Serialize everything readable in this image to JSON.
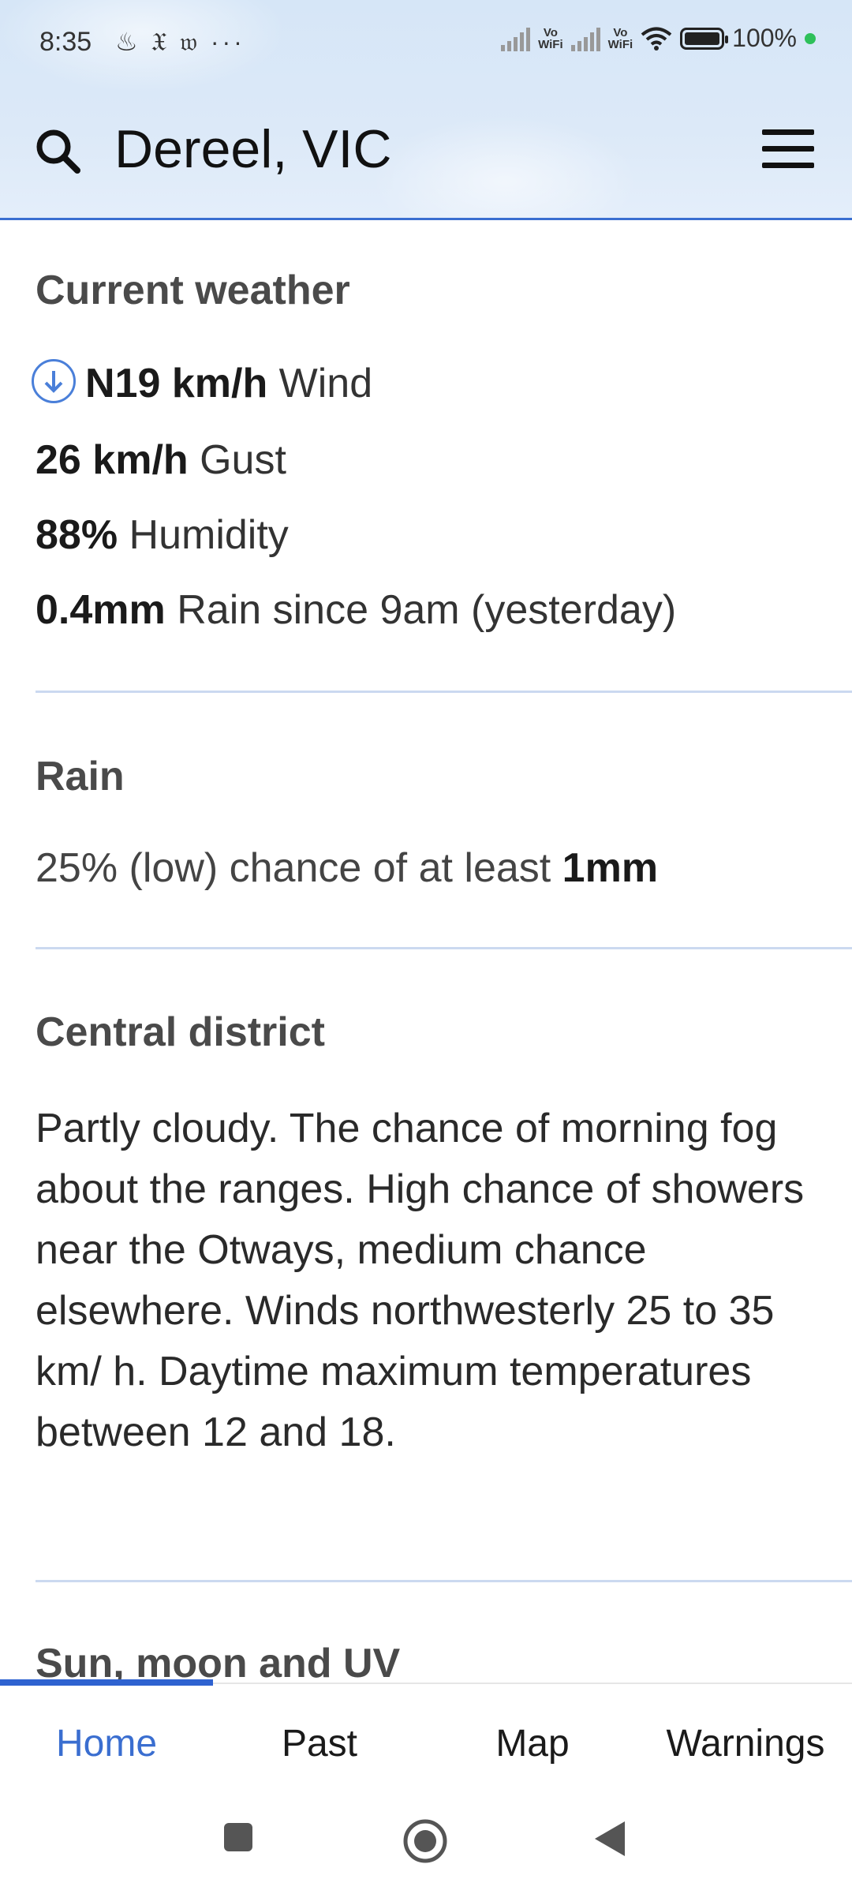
{
  "status_bar": {
    "time": "8:35",
    "notification_icons": [
      "flame-icon",
      "nyt-icon",
      "wp-icon"
    ],
    "more": "···",
    "vowifi_label": "Vo\nWiFi",
    "battery": "100%"
  },
  "header": {
    "location": "Dereel, VIC"
  },
  "current_weather": {
    "title": "Current weather",
    "wind_value": "N19 km/h",
    "wind_label": "Wind",
    "gust_value": "26 km/h",
    "gust_label": "Gust",
    "humidity_value": "88%",
    "humidity_label": "Humidity",
    "rain_value": "0.4mm",
    "rain_label": "Rain since 9am (yesterday)"
  },
  "rain": {
    "title": "Rain",
    "chance_text": "25% (low) chance of at least ",
    "amount": "1mm"
  },
  "district": {
    "title": "Central district",
    "forecast": "Partly cloudy. The chance of morning fog about the ranges. High chance of showers near the Otways, medium chance elsewhere. Winds northwesterly 25 to 35 km/ h. Daytime maximum temperatures between 12 and 18."
  },
  "sun_moon": {
    "title": "Sun, moon and UV"
  },
  "tabs": [
    {
      "label": "Home"
    },
    {
      "label": "Past"
    },
    {
      "label": "Map"
    },
    {
      "label": "Warnings"
    }
  ],
  "colors": {
    "accent": "#3a6ed0",
    "divider": "#cbd9f0"
  }
}
